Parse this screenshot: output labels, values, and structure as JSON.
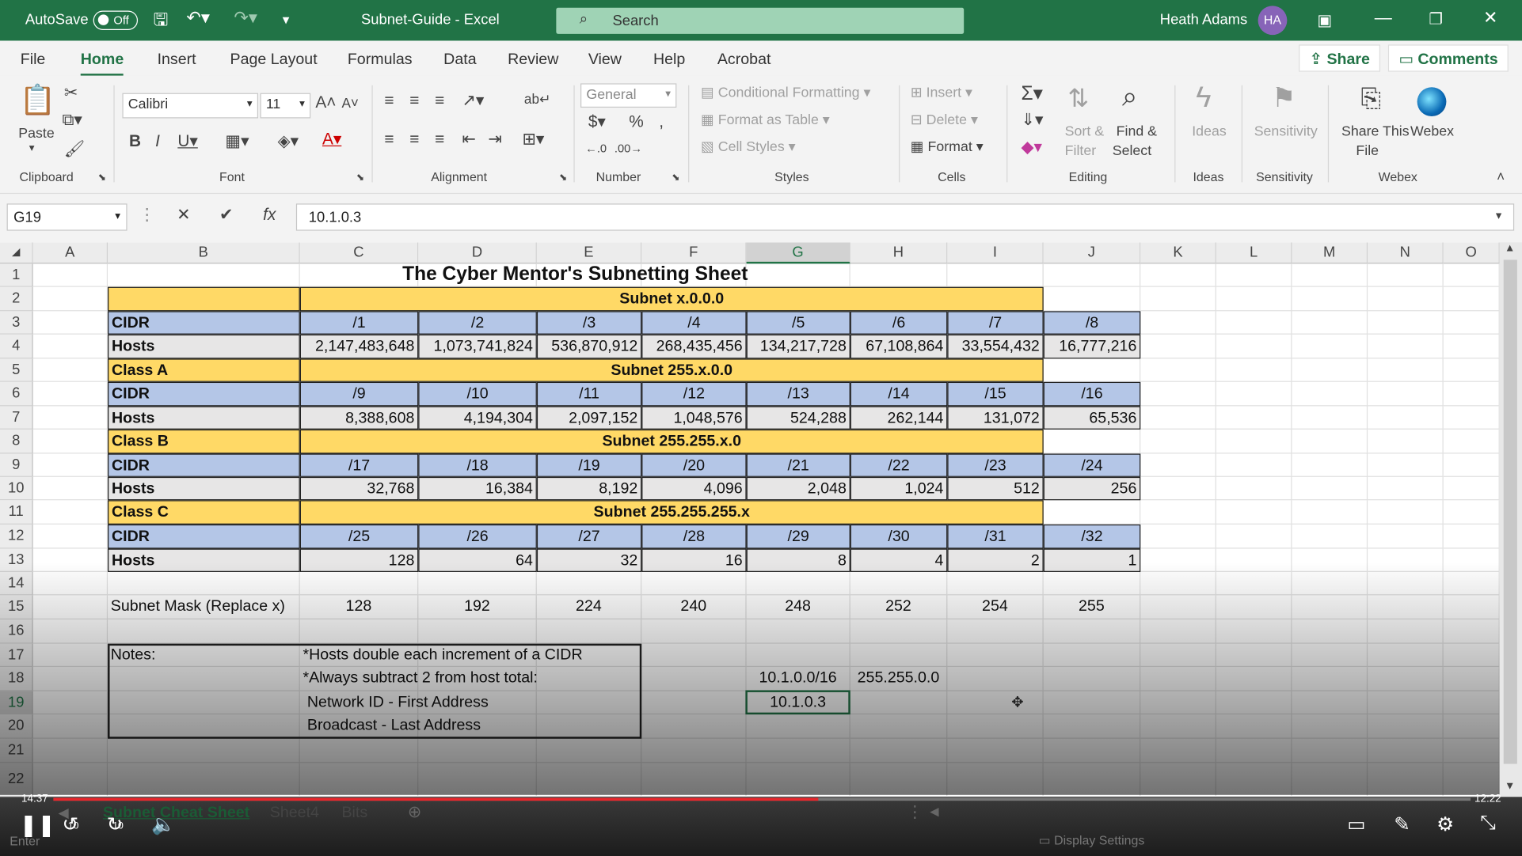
{
  "titlebar": {
    "autosave": "AutoSave",
    "autosave_state": "Off",
    "doc_title": "Subnet-Guide  -  Excel",
    "search_placeholder": "Search",
    "user_name": "Heath Adams",
    "user_initials": "HA"
  },
  "tabs": [
    "File",
    "Home",
    "Insert",
    "Page Layout",
    "Formulas",
    "Data",
    "Review",
    "View",
    "Help",
    "Acrobat"
  ],
  "share_label": "Share",
  "comments_label": "Comments",
  "ribbon": {
    "clipboard": {
      "paste": "Paste",
      "group": "Clipboard"
    },
    "font": {
      "name": "Calibri",
      "size": "11",
      "group": "Font"
    },
    "alignment": {
      "group": "Alignment"
    },
    "number": {
      "format": "General",
      "group": "Number"
    },
    "styles": {
      "conditional": "Conditional Formatting",
      "table": "Format as Table",
      "cell": "Cell Styles",
      "group": "Styles"
    },
    "cells": {
      "insert": "Insert",
      "delete": "Delete",
      "format": "Format",
      "group": "Cells"
    },
    "editing": {
      "sort1": "Sort &",
      "sort2": "Filter",
      "find1": "Find &",
      "find2": "Select",
      "group": "Editing"
    },
    "ideas": {
      "label": "Ideas",
      "group": "Ideas"
    },
    "sensitivity": {
      "label": "Sensitivity",
      "group": "Sensitivity"
    },
    "webex": {
      "share1": "Share This",
      "share2": "File",
      "label": "Webex",
      "group": "Webex"
    }
  },
  "formula_bar": {
    "cell_ref": "G19",
    "fx": "fx",
    "value": "10.1.0.3"
  },
  "columns": [
    "A",
    "B",
    "C",
    "D",
    "E",
    "F",
    "G",
    "H",
    "I",
    "J",
    "K",
    "L",
    "M",
    "N",
    "O"
  ],
  "rows": [
    "1",
    "2",
    "3",
    "4",
    "5",
    "6",
    "7",
    "8",
    "9",
    "10",
    "11",
    "12",
    "13",
    "14",
    "15",
    "16",
    "17",
    "18",
    "19",
    "20",
    "21",
    "22"
  ],
  "sheet": {
    "title": "The Cyber Mentor's Subnetting Sheet",
    "cidr_label": "CIDR",
    "hosts_label": "Hosts",
    "blocks": [
      {
        "label": "",
        "subnet": "Subnet x.0.0.0",
        "cidr": [
          "/1",
          "/2",
          "/3",
          "/4",
          "/5",
          "/6",
          "/7",
          "/8"
        ],
        "hosts": [
          "2,147,483,648",
          "1,073,741,824",
          "536,870,912",
          "268,435,456",
          "134,217,728",
          "67,108,864",
          "33,554,432",
          "16,777,216"
        ]
      },
      {
        "label": "Class A",
        "subnet": "Subnet 255.x.0.0",
        "cidr": [
          "/9",
          "/10",
          "/11",
          "/12",
          "/13",
          "/14",
          "/15",
          "/16"
        ],
        "hosts": [
          "8,388,608",
          "4,194,304",
          "2,097,152",
          "1,048,576",
          "524,288",
          "262,144",
          "131,072",
          "65,536"
        ]
      },
      {
        "label": "Class B",
        "subnet": "Subnet 255.255.x.0",
        "cidr": [
          "/17",
          "/18",
          "/19",
          "/20",
          "/21",
          "/22",
          "/23",
          "/24"
        ],
        "hosts": [
          "32,768",
          "16,384",
          "8,192",
          "4,096",
          "2,048",
          "1,024",
          "512",
          "256"
        ]
      },
      {
        "label": "Class C",
        "subnet": "Subnet 255.255.255.x",
        "cidr": [
          "/25",
          "/26",
          "/27",
          "/28",
          "/29",
          "/30",
          "/31",
          "/32"
        ],
        "hosts": [
          "128",
          "64",
          "32",
          "16",
          "8",
          "4",
          "2",
          "1"
        ]
      }
    ],
    "mask_label": "Subnet Mask (Replace x)",
    "mask_values": [
      "128",
      "192",
      "224",
      "240",
      "248",
      "252",
      "254",
      "255"
    ],
    "notes_label": "Notes:",
    "notes": [
      "*Hosts double each increment of a CIDR",
      "*Always subtract 2 from host total:",
      " Network ID - First Address",
      " Broadcast - Last Address"
    ],
    "g18": "10.1.0.0/16",
    "h18": "255.255.0.0",
    "g19": "10.1.0.3"
  },
  "sheet_tabs": [
    "Subnet Cheat Sheet",
    "Sheet4",
    "Bits"
  ],
  "video": {
    "elapsed": "14:37",
    "remaining": "12:22",
    "progress_fraction": 0.54,
    "skip_back": "10",
    "skip_fwd": "10"
  },
  "status": {
    "ready": "Enter",
    "display": "Display Settings"
  }
}
